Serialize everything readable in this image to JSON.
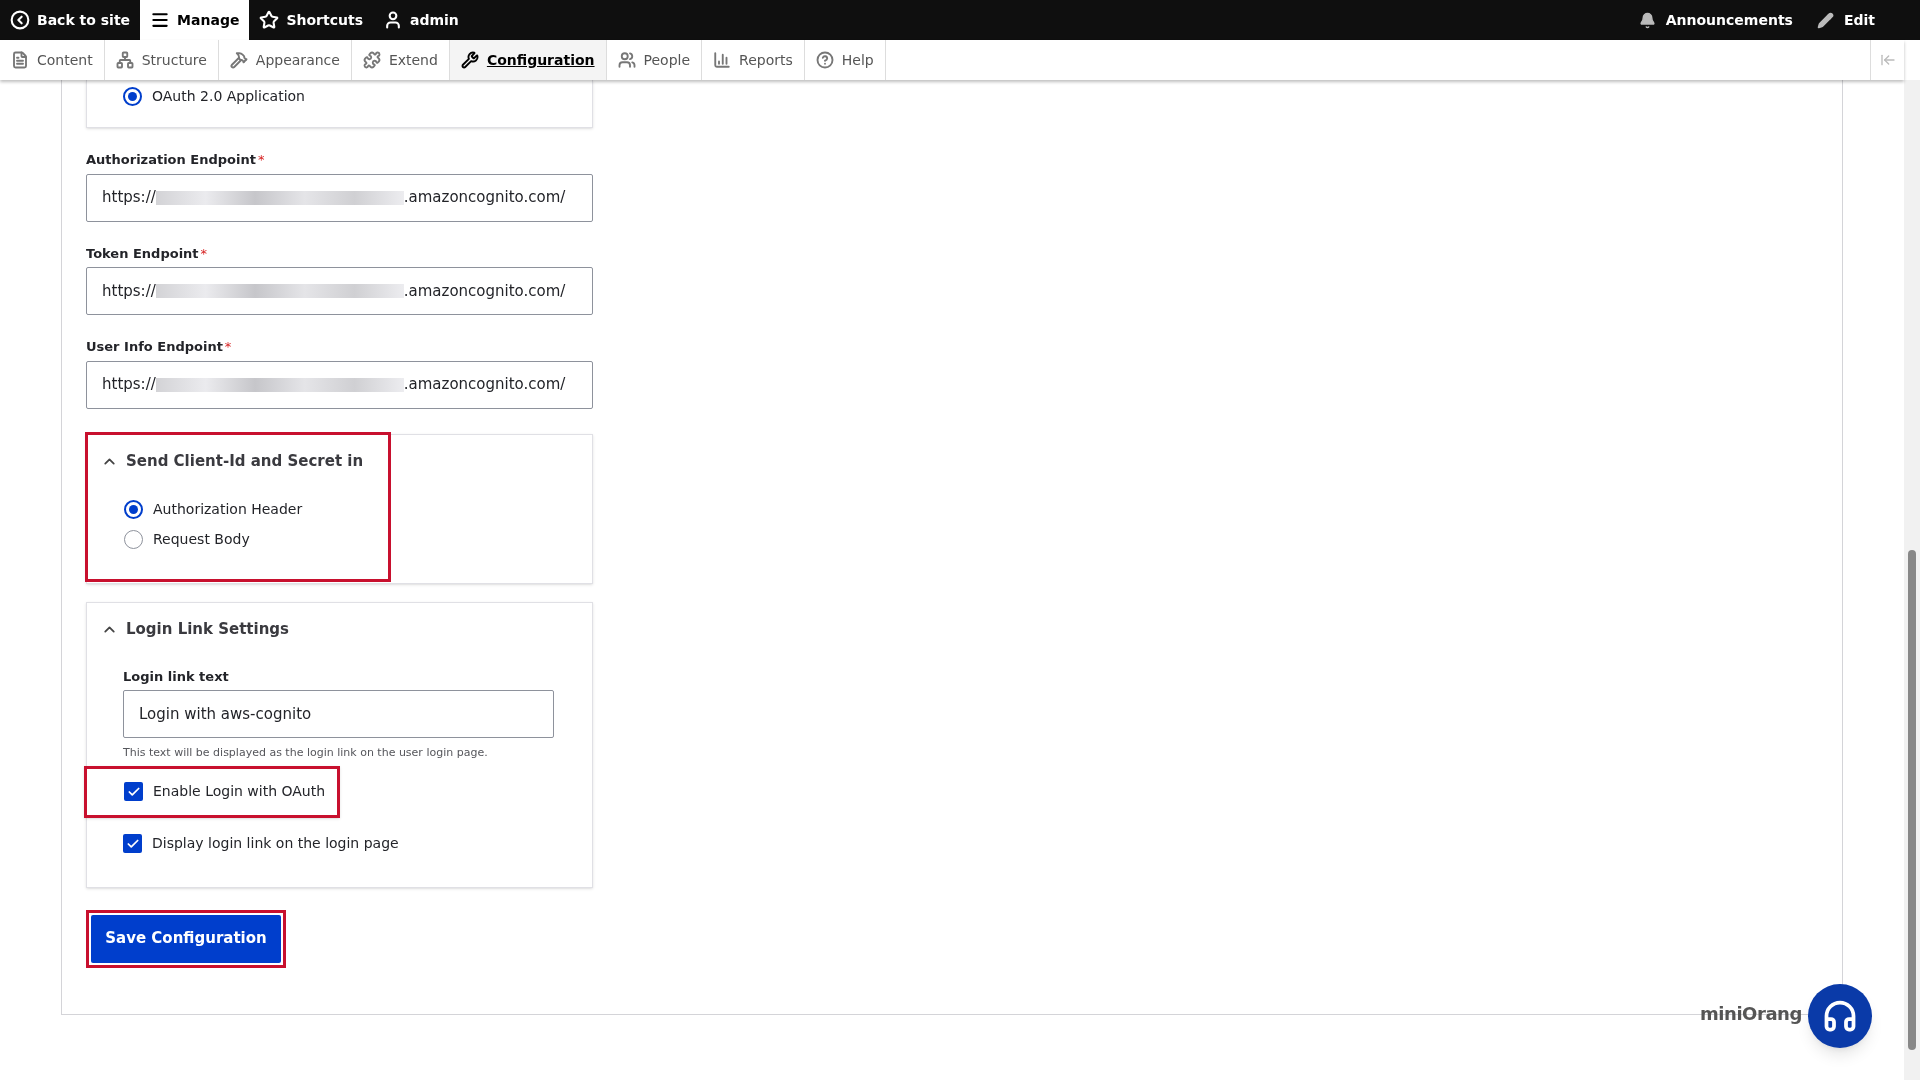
{
  "toolbar": {
    "items": [
      {
        "label": "Back to site",
        "kind": "back",
        "selected": false
      },
      {
        "label": "Manage",
        "kind": "menu",
        "selected": true
      },
      {
        "label": "Shortcuts",
        "kind": "star",
        "selected": false
      },
      {
        "label": "admin",
        "kind": "user",
        "selected": false
      }
    ],
    "right_items": [
      {
        "label": "Announcements",
        "kind": "bell"
      },
      {
        "label": "Edit",
        "kind": "pencil"
      }
    ]
  },
  "tabs": [
    {
      "label": "Content",
      "kind": "file",
      "selected": false
    },
    {
      "label": "Structure",
      "kind": "structure",
      "selected": false
    },
    {
      "label": "Appearance",
      "kind": "brush",
      "selected": false
    },
    {
      "label": "Extend",
      "kind": "puzzle",
      "selected": false
    },
    {
      "label": "Configuration",
      "kind": "wrench",
      "selected": true
    },
    {
      "label": "People",
      "kind": "people",
      "selected": false
    },
    {
      "label": "Reports",
      "kind": "chart",
      "selected": false
    },
    {
      "label": "Help",
      "kind": "help",
      "selected": false
    }
  ],
  "app_type": {
    "options": [
      {
        "label": "OAuth 2.0 Application",
        "selected": true
      }
    ]
  },
  "endpoints": [
    {
      "label": "Authorization Endpoint",
      "required_mark": "*",
      "value_start": "https://",
      "value_end": ".amazoncognito.com/"
    },
    {
      "label": "Token Endpoint",
      "required_mark": "*",
      "value_start": "https://",
      "value_end": ".amazoncognito.com/"
    },
    {
      "label": "User Info Endpoint",
      "required_mark": "*",
      "value_start": "https://",
      "value_end": ".amazoncognito.com/"
    }
  ],
  "client_secret": {
    "title": "Send Client-Id and Secret in",
    "expanded": true,
    "highlighted": true,
    "options": [
      {
        "label": "Authorization Header",
        "selected": true
      },
      {
        "label": "Request Body",
        "selected": false
      }
    ]
  },
  "login_link": {
    "title": "Login Link Settings",
    "expanded": true,
    "field_label": "Login link text",
    "value": "Login with aws-cognito",
    "description": "This text will be displayed as the login link on the user login page.",
    "checkboxes": [
      {
        "label": "Enable Login with OAuth",
        "checked": true,
        "highlighted": true
      },
      {
        "label": "Display login link on the login page",
        "checked": true,
        "highlighted": false
      }
    ]
  },
  "save_button": {
    "label": "Save Configuration",
    "highlighted": true
  },
  "logo": {
    "text": "miniOrang"
  }
}
